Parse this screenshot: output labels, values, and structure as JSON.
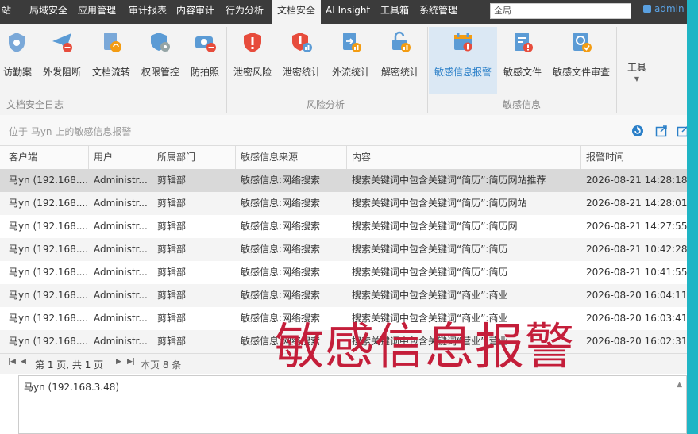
{
  "menubar": {
    "items": [
      "站",
      "局域安全",
      "应用管理",
      "审计报表",
      "内容审计",
      "行为分析",
      "文档安全",
      "AI Insight",
      "工具箱",
      "系统管理"
    ],
    "active_index": 6,
    "search_placeholder": "全局",
    "user": "admin"
  },
  "ribbon": {
    "buttons": [
      {
        "label": "访勤案",
        "icon": "shield-settings-icon"
      },
      {
        "label": "外发阻断",
        "icon": "send-block-icon"
      },
      {
        "label": "文档流转",
        "icon": "document-flow-icon"
      },
      {
        "label": "权限管控",
        "icon": "permission-shield-icon"
      },
      {
        "label": "防拍照",
        "icon": "camera-block-icon"
      },
      {
        "label": "泄密风险",
        "icon": "leak-risk-icon"
      },
      {
        "label": "泄密统计",
        "icon": "leak-stats-icon"
      },
      {
        "label": "外流统计",
        "icon": "outflow-stats-icon"
      },
      {
        "label": "解密统计",
        "icon": "decrypt-stats-icon"
      },
      {
        "label": "敏感信息报警",
        "icon": "sensitive-alert-icon"
      },
      {
        "label": "敏感文件",
        "icon": "sensitive-file-icon"
      },
      {
        "label": "敏感文件审查",
        "icon": "sensitive-review-icon"
      },
      {
        "label": "工具",
        "icon": "tools-dropdown-icon"
      }
    ],
    "selected_index": 9,
    "groups": [
      "文档安全日志",
      "风险分析",
      "敏感信息"
    ]
  },
  "breadcrumb": "位于 马yn 上的敏感信息报警",
  "table": {
    "columns": [
      "客户端",
      "用户",
      "所属部门",
      "敏感信息来源",
      "内容",
      "报警时间"
    ],
    "rows": [
      [
        "马yn (192.168....",
        "Administr...",
        "剪辑部",
        "敏感信息:网络搜索",
        "搜索关键词中包含关键词“简历”:简历网站推荐",
        "2026-08-21 14:28:18"
      ],
      [
        "马yn (192.168....",
        "Administr...",
        "剪辑部",
        "敏感信息:网络搜索",
        "搜索关键词中包含关键词“简历”:简历网站",
        "2026-08-21 14:28:01"
      ],
      [
        "马yn (192.168....",
        "Administr...",
        "剪辑部",
        "敏感信息:网络搜索",
        "搜索关键词中包含关键词“简历”:简历网",
        "2026-08-21 14:27:55"
      ],
      [
        "马yn (192.168....",
        "Administr...",
        "剪辑部",
        "敏感信息:网络搜索",
        "搜索关键词中包含关键词“简历”:简历",
        "2026-08-21 10:42:28"
      ],
      [
        "马yn (192.168....",
        "Administr...",
        "剪辑部",
        "敏感信息:网络搜索",
        "搜索关键词中包含关键词“简历”:简历",
        "2026-08-21 10:41:55"
      ],
      [
        "马yn (192.168....",
        "Administr...",
        "剪辑部",
        "敏感信息:网络搜索",
        "搜索关键词中包含关键词“商业”:商业",
        "2026-08-20 16:04:11"
      ],
      [
        "马yn (192.168....",
        "Administr...",
        "剪辑部",
        "敏感信息:网络搜索",
        "搜索关键词中包含关键词“商业”:商业",
        "2026-08-20 16:03:41"
      ],
      [
        "马yn (192.168....",
        "Administr...",
        "剪辑部",
        "敏感信息:网络搜索",
        "搜索关键词中包含关键词“营业”:营业",
        "2026-08-20 16:02:31"
      ]
    ],
    "selected_row": 0
  },
  "pager": {
    "page_text": "第 1 页, 共 1 页",
    "count_text": "本页 8 条"
  },
  "detail": {
    "text": "马yn (192.168.3.48)"
  },
  "overlay_title": "敏感信息报警",
  "colors": {
    "accent": "#2a7fc8",
    "overlay": "#c41e3a",
    "frame": "#1fb5c5"
  }
}
